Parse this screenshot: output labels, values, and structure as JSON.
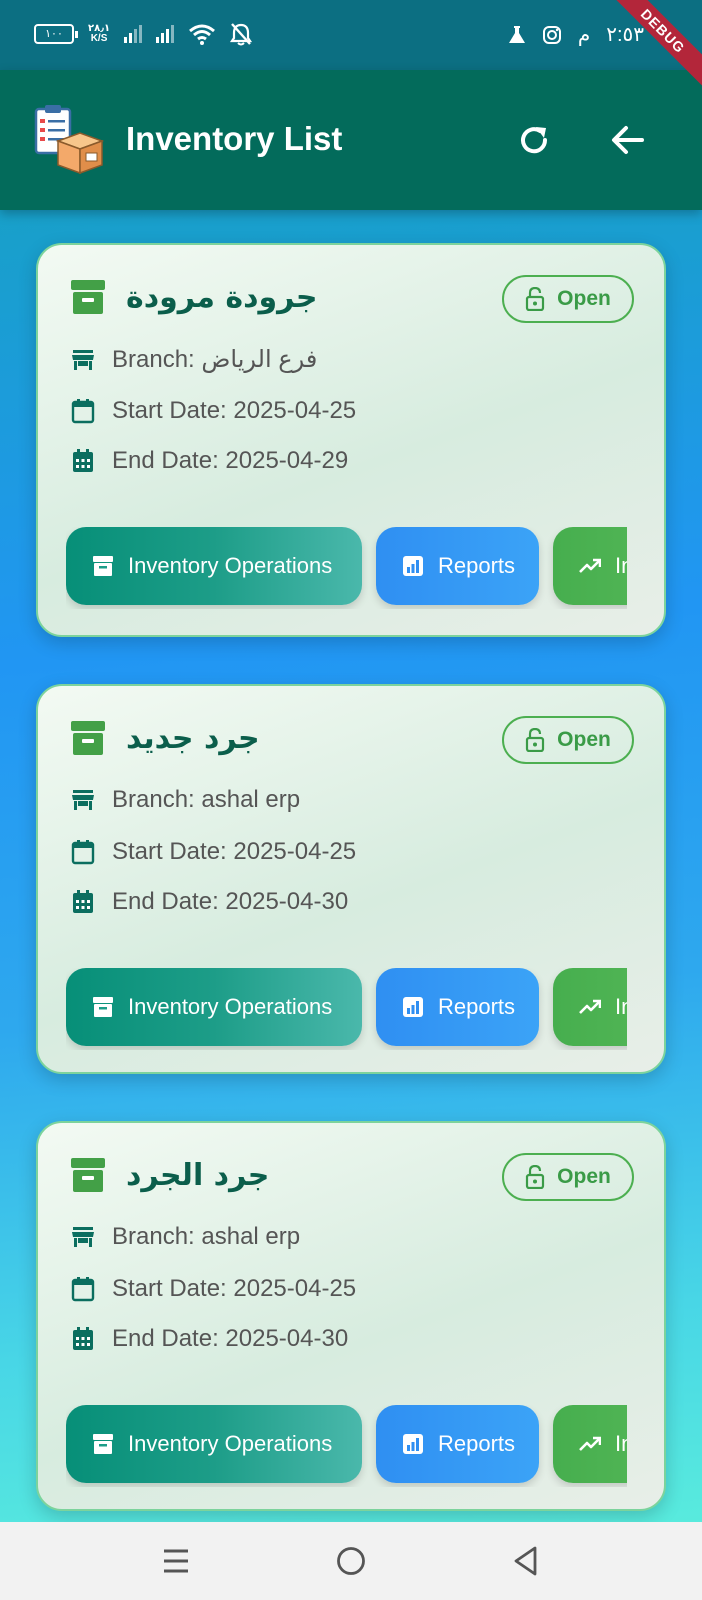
{
  "status_bar": {
    "battery": "١٠٠",
    "net_speed_value": "٢٨٫١",
    "net_speed_unit": "K/S",
    "time": "٢:٥٣",
    "time_suffix": "م"
  },
  "debug_banner": "DEBUG",
  "app_bar": {
    "title": "Inventory List"
  },
  "colors": {
    "app_bar": "#036b5b",
    "status_open": "#4caf50",
    "btn_operations": "#078f78",
    "btn_reports": "#2f8ff2",
    "btn_increase": "#46ae4e"
  },
  "inventories": [
    {
      "name": "جرودة مرودة",
      "status": "Open",
      "branch": "Branch: فرع الرياض",
      "start_date": "Start Date: 2025-04-25",
      "end_date": "End Date: 2025-04-29",
      "actions": {
        "operations": "Inventory Operations",
        "reports": "Reports",
        "increase": "Inc"
      }
    },
    {
      "name": "جرد جديد",
      "status": "Open",
      "branch": "Branch: ashal erp",
      "start_date": "Start Date: 2025-04-25",
      "end_date": "End Date: 2025-04-30",
      "actions": {
        "operations": "Inventory Operations",
        "reports": "Reports",
        "increase": "Inc"
      }
    },
    {
      "name": "جرد الجرد",
      "status": "Open",
      "branch": "Branch: ashal erp",
      "start_date": "Start Date: 2025-04-25",
      "end_date": "End Date: 2025-04-30",
      "actions": {
        "operations": "Inventory Operations",
        "reports": "Reports",
        "increase": "Inc"
      }
    }
  ],
  "icons": {
    "appbar": [
      "inventory-logo-icon",
      "refresh-icon",
      "arrow-back-icon"
    ],
    "card": [
      "archive-icon",
      "lock-open-icon",
      "store-icon",
      "calendar-icon",
      "calendar-grid-icon",
      "bar-chart-icon",
      "trending-up-icon"
    ],
    "nav": [
      "menu-icon",
      "home-circle-icon",
      "back-triangle-icon"
    ]
  }
}
